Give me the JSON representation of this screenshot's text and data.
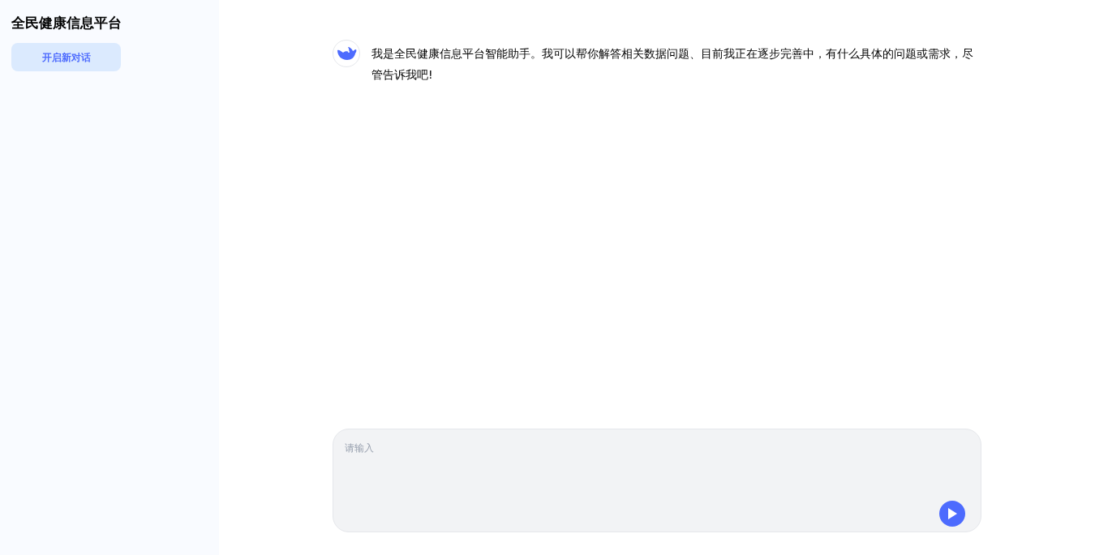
{
  "sidebar": {
    "title": "全民健康信息平台",
    "new_chat_button": "开启新对话"
  },
  "messages": [
    {
      "kind": "assistant",
      "text": "我是全民健康信息平台智能助手。我可以帮你解答相关数据问题、目前我正在逐步完善中，有什么具体的问题或需求，尽管告诉我吧!"
    }
  ],
  "composer": {
    "placeholder": "请输入"
  }
}
